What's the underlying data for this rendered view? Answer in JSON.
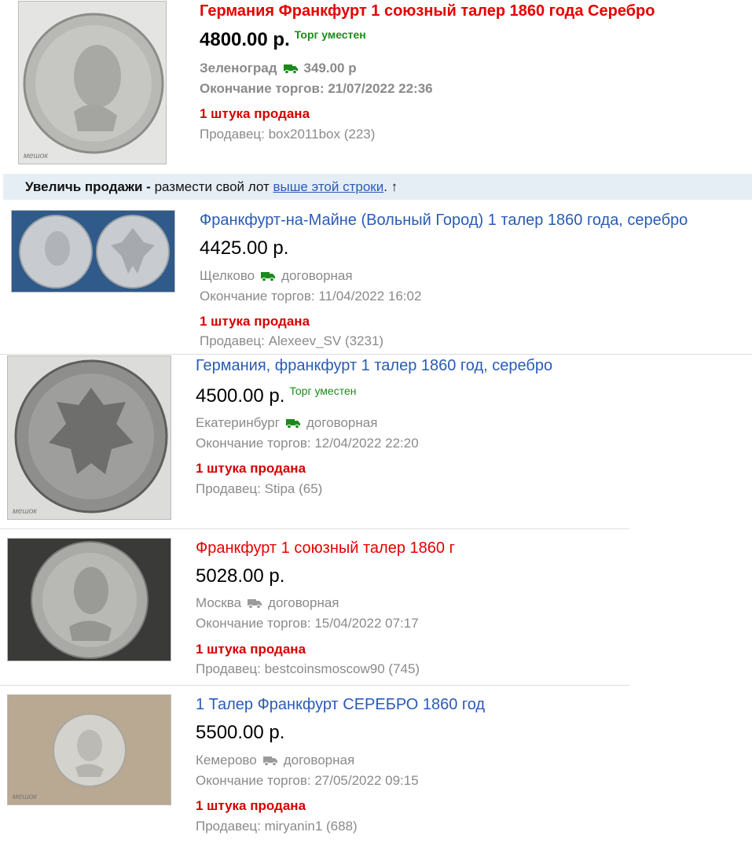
{
  "promo": {
    "bold": "Увеличь продажи -",
    "text": " размести свой лот ",
    "link": "выше этой строки",
    "tail": ". ↑"
  },
  "listings": [
    {
      "title": "Германия Франкфурт 1 союзный талер 1860 года Серебро",
      "price": "4800.00 р.",
      "bargain": "Торг уместен",
      "city": "Зеленоград",
      "delivery": "349.00 р",
      "end": "Окончание торгов: 21/07/2022 22:36",
      "sold": "1 штука продана",
      "seller": "Продавец: box2011box (223)",
      "watermark": "мешок",
      "truck_color": "#1b8a1b"
    },
    {
      "title": "Франкфурт-на-Майне (Вольный Город) 1 талер 1860 года, серебро",
      "price": "4425.00 р.",
      "city": "Щелково",
      "delivery": "договорная",
      "end": "Окончание торгов: 11/04/2022 16:02",
      "sold": "1 штука продана",
      "seller": "Продавец: Alexeev_SV (3231)",
      "truck_color": "#1b8a1b"
    },
    {
      "title": "Германия, франкфурт 1 талер 1860 год, серебро",
      "price": "4500.00 р.",
      "bargain": "Торг уместен",
      "city": "Екатеринбург",
      "delivery": "договорная",
      "end": "Окончание торгов: 12/04/2022 22:20",
      "sold": "1 штука продана",
      "seller": "Продавец: Stipa (65)",
      "watermark": "мешок",
      "truck_color": "#1b8a1b"
    },
    {
      "title": "Франкфурт 1 союзный талер 1860 г",
      "price": "5028.00 р.",
      "city": "Москва",
      "delivery": "договорная",
      "end": "Окончание торгов: 15/04/2022 07:17",
      "sold": "1 штука продана",
      "seller": "Продавец: bestcoinsmoscow90 (745)",
      "truck_color": "#9a9a9a"
    },
    {
      "title": "1 Талер Франкфурт СЕРЕБРО 1860 год",
      "price": "5500.00 р.",
      "city": "Кемерово",
      "delivery": "договорная",
      "end": "Окончание торгов: 27/05/2022 09:15",
      "sold": "1 штука продана",
      "seller": "Продавец: miryanin1 (688)",
      "watermark": "мешок",
      "truck_color": "#9a9a9a"
    }
  ]
}
